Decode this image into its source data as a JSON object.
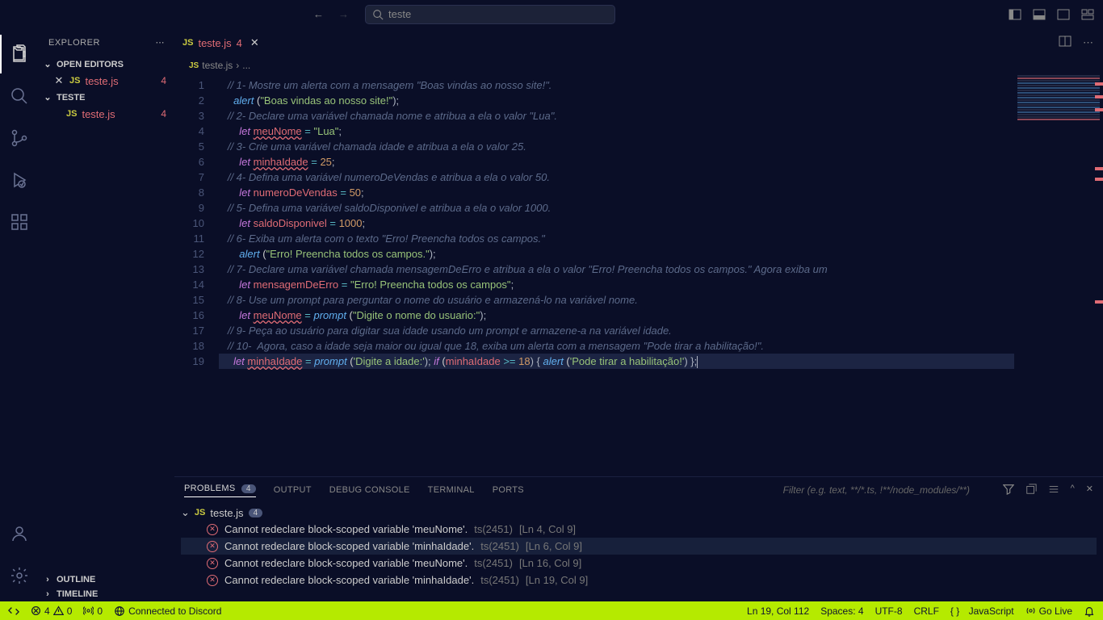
{
  "title_search": "teste",
  "explorer": {
    "title": "EXPLORER",
    "open_editors_label": "OPEN EDITORS",
    "folder_label": "TESTE",
    "outline_label": "OUTLINE",
    "timeline_label": "TIMELINE",
    "items": [
      {
        "name": "teste.js",
        "errors": "4"
      }
    ],
    "folder_items": [
      {
        "name": "teste.js",
        "errors": "4"
      }
    ]
  },
  "tab": {
    "name": "teste.js",
    "errors": "4"
  },
  "breadcrumb": {
    "file": "teste.js",
    "sep": "›",
    "dots": "..."
  },
  "code_lines": [
    [
      [
        "   ",
        ""
      ],
      [
        "// 1- Mostre um alerta com a mensagem \"Boas vindas ao nosso site!\".",
        "c-comment"
      ]
    ],
    [
      [
        "     ",
        ""
      ],
      [
        "alert",
        "c-fn"
      ],
      [
        " (",
        ""
      ],
      [
        "\"Boas vindas ao nosso site!\"",
        "c-str"
      ],
      [
        ");",
        "c-pun"
      ]
    ],
    [
      [
        "   ",
        ""
      ],
      [
        "// 2- Declare uma variável chamada nome e atribua a ela o valor \"Lua\".",
        "c-comment"
      ]
    ],
    [
      [
        "       ",
        ""
      ],
      [
        "let",
        "c-key"
      ],
      [
        " ",
        ""
      ],
      [
        "meuNome",
        "c-var c-err"
      ],
      [
        " ",
        ""
      ],
      [
        "=",
        "c-op"
      ],
      [
        " ",
        ""
      ],
      [
        "\"Lua\"",
        "c-str"
      ],
      [
        ";",
        "c-pun"
      ]
    ],
    [
      [
        "   ",
        ""
      ],
      [
        "// 3- Crie uma variável chamada idade e atribua a ela o valor 25.",
        "c-comment"
      ]
    ],
    [
      [
        "       ",
        ""
      ],
      [
        "let",
        "c-key"
      ],
      [
        " ",
        ""
      ],
      [
        "minhaIdade",
        "c-var c-err"
      ],
      [
        " ",
        ""
      ],
      [
        "=",
        "c-op"
      ],
      [
        " ",
        ""
      ],
      [
        "25",
        "c-num"
      ],
      [
        ";",
        "c-pun"
      ]
    ],
    [
      [
        "   ",
        ""
      ],
      [
        "// 4- Defina uma variável numeroDeVendas e atribua a ela o valor 50.",
        "c-comment"
      ]
    ],
    [
      [
        "       ",
        ""
      ],
      [
        "let",
        "c-key"
      ],
      [
        " ",
        ""
      ],
      [
        "numeroDeVendas",
        "c-var"
      ],
      [
        " ",
        ""
      ],
      [
        "=",
        "c-op"
      ],
      [
        " ",
        ""
      ],
      [
        "50",
        "c-num"
      ],
      [
        ";",
        "c-pun"
      ]
    ],
    [
      [
        "   ",
        ""
      ],
      [
        "// 5- Defina uma variável saldoDisponivel e atribua a ela o valor 1000.",
        "c-comment"
      ]
    ],
    [
      [
        "       ",
        ""
      ],
      [
        "let",
        "c-key"
      ],
      [
        " ",
        ""
      ],
      [
        "saldoDisponivel",
        "c-var"
      ],
      [
        " ",
        ""
      ],
      [
        "=",
        "c-op"
      ],
      [
        " ",
        ""
      ],
      [
        "1000",
        "c-num"
      ],
      [
        ";",
        "c-pun"
      ]
    ],
    [
      [
        "   ",
        ""
      ],
      [
        "// 6- Exiba um alerta com o texto \"Erro! Preencha todos os campos.\"",
        "c-comment"
      ]
    ],
    [
      [
        "       ",
        ""
      ],
      [
        "alert",
        "c-fn"
      ],
      [
        " (",
        ""
      ],
      [
        "\"Erro! Preencha todos os campos.\"",
        "c-str"
      ],
      [
        ");",
        "c-pun"
      ]
    ],
    [
      [
        "   ",
        ""
      ],
      [
        "// 7- Declare uma variável chamada mensagemDeErro e atribua a ela o valor \"Erro! Preencha todos os campos.\" Agora exiba um",
        "c-comment"
      ]
    ],
    [
      [
        "       ",
        ""
      ],
      [
        "let",
        "c-key"
      ],
      [
        " ",
        ""
      ],
      [
        "mensagemDeErro",
        "c-var"
      ],
      [
        " ",
        ""
      ],
      [
        "=",
        "c-op"
      ],
      [
        " ",
        ""
      ],
      [
        "\"Erro! Preencha todos os campos\"",
        "c-str"
      ],
      [
        ";",
        "c-pun"
      ]
    ],
    [
      [
        "   ",
        ""
      ],
      [
        "// 8- Use um prompt para perguntar o nome do usuário e armazená-lo na variável nome.",
        "c-comment"
      ]
    ],
    [
      [
        "       ",
        ""
      ],
      [
        "let",
        "c-key"
      ],
      [
        " ",
        ""
      ],
      [
        "meuNome",
        "c-var c-err"
      ],
      [
        " ",
        ""
      ],
      [
        "=",
        "c-op"
      ],
      [
        " ",
        ""
      ],
      [
        "prompt",
        "c-fn"
      ],
      [
        " (",
        ""
      ],
      [
        "\"Digite o nome do usuario:\"",
        "c-str"
      ],
      [
        ");",
        "c-pun"
      ]
    ],
    [
      [
        "   ",
        ""
      ],
      [
        "// 9- Peça ao usuário para digitar sua idade usando um prompt e armazene-a na variável idade.",
        "c-comment"
      ]
    ],
    [
      [
        "   ",
        ""
      ],
      [
        "// 10-  Agora, caso a idade seja maior ou igual que 18, exiba um alerta com a mensagem \"Pode tirar a habilitação!\".",
        "c-comment"
      ]
    ],
    [
      [
        "     ",
        ""
      ],
      [
        "let",
        "c-key"
      ],
      [
        " ",
        ""
      ],
      [
        "minhaIdade",
        "c-var c-err"
      ],
      [
        " ",
        ""
      ],
      [
        "=",
        "c-op"
      ],
      [
        " ",
        ""
      ],
      [
        "prompt",
        "c-fn"
      ],
      [
        " (",
        ""
      ],
      [
        "'Digite a idade:'",
        "c-str"
      ],
      [
        ");",
        "c-pun"
      ],
      [
        " ",
        ""
      ],
      [
        "if",
        "c-key"
      ],
      [
        " (",
        ""
      ],
      [
        "minhaIdade",
        "c-var"
      ],
      [
        " ",
        ""
      ],
      [
        ">=",
        "c-op"
      ],
      [
        " ",
        ""
      ],
      [
        "18",
        "c-num"
      ],
      [
        ") { ",
        "c-pun"
      ],
      [
        "alert",
        "c-fn"
      ],
      [
        " (",
        ""
      ],
      [
        "'Pode tirar a habilitação!'",
        "c-str"
      ],
      [
        ") };",
        "c-pun"
      ]
    ]
  ],
  "line_hl": 19,
  "panel": {
    "tabs": {
      "problems": "PROBLEMS",
      "output": "OUTPUT",
      "debug": "DEBUG CONSOLE",
      "terminal": "TERMINAL",
      "ports": "PORTS"
    },
    "problems_count": "4",
    "filter_placeholder": "Filter (e.g. text, **/*.ts, !**/node_modules/**)",
    "file": "teste.js",
    "file_count": "4",
    "items": [
      {
        "msg": "Cannot redeclare block-scoped variable 'meuNome'.",
        "code": "ts(2451)",
        "loc": "[Ln 4, Col 9]",
        "sel": false
      },
      {
        "msg": "Cannot redeclare block-scoped variable 'minhaIdade'.",
        "code": "ts(2451)",
        "loc": "[Ln 6, Col 9]",
        "sel": true
      },
      {
        "msg": "Cannot redeclare block-scoped variable 'meuNome'.",
        "code": "ts(2451)",
        "loc": "[Ln 16, Col 9]",
        "sel": false
      },
      {
        "msg": "Cannot redeclare block-scoped variable 'minhaIdade'.",
        "code": "ts(2451)",
        "loc": "[Ln 19, Col 9]",
        "sel": false
      }
    ]
  },
  "status": {
    "errors": "4",
    "warnings": "0",
    "ports": "0",
    "discord": "Connected to Discord",
    "ln_col": "Ln 19, Col 112",
    "spaces": "Spaces: 4",
    "encoding": "UTF-8",
    "eol": "CRLF",
    "lang_brackets": "{ }",
    "lang": "JavaScript",
    "golive": "Go Live"
  }
}
